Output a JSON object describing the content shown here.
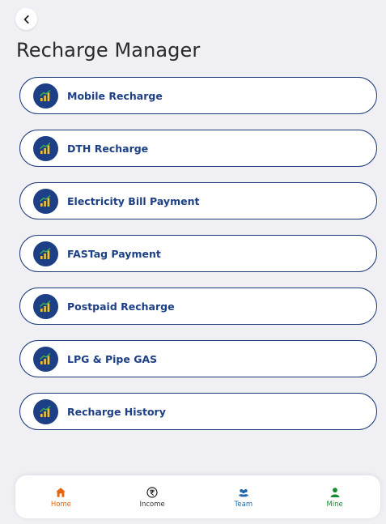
{
  "header": {
    "title": "Recharge Manager",
    "back_icon": "chevron-left-icon"
  },
  "menu": {
    "icon": "signal-bars-icon",
    "items": [
      {
        "label": "Mobile Recharge"
      },
      {
        "label": "DTH Recharge"
      },
      {
        "label": "Electricity Bill Payment"
      },
      {
        "label": "FASTag Payment"
      },
      {
        "label": "Postpaid Recharge"
      },
      {
        "label": "LPG & Pipe GAS"
      },
      {
        "label": "Recharge History"
      }
    ]
  },
  "bottom_nav": {
    "items": [
      {
        "label": "Home",
        "icon": "home-icon",
        "color": "#e8640a"
      },
      {
        "label": "Income",
        "icon": "rupee-icon",
        "color": "#333333"
      },
      {
        "label": "Team",
        "icon": "team-icon",
        "color": "#1f67a8"
      },
      {
        "label": "Mine",
        "icon": "user-icon",
        "color": "#198a2e"
      }
    ]
  },
  "colors": {
    "background": "#efeff4",
    "accent": "#1d3f85",
    "icon_bars": "#f2c230"
  }
}
